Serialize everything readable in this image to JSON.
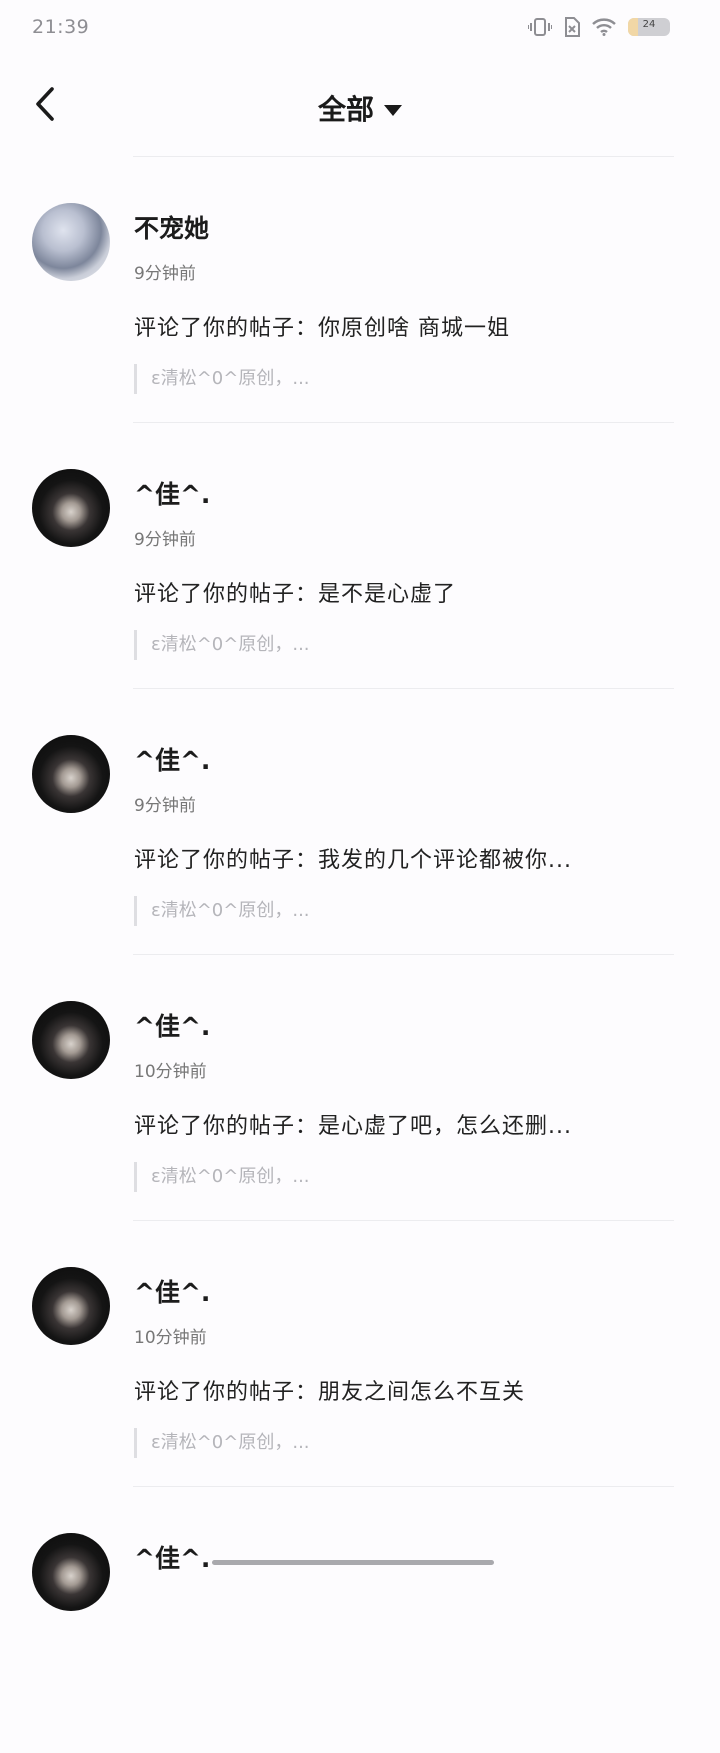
{
  "status_bar": {
    "time": "21:39",
    "battery": "24"
  },
  "nav": {
    "title": "全部"
  },
  "notifications": [
    {
      "user": "不宠她",
      "time": "9分钟前",
      "text": "评论了你的帖子：你原创啥 商城一姐",
      "quote": "ε清松^0^原创，..."
    },
    {
      "user": "^佳^.",
      "time": "9分钟前",
      "text": "评论了你的帖子：是不是心虚了",
      "quote": "ε清松^0^原创，..."
    },
    {
      "user": "^佳^.",
      "time": "9分钟前",
      "text": "评论了你的帖子：我发的几个评论都被你...",
      "quote": "ε清松^0^原创，..."
    },
    {
      "user": "^佳^.",
      "time": "10分钟前",
      "text": "评论了你的帖子：是心虚了吧，怎么还删...",
      "quote": "ε清松^0^原创，..."
    },
    {
      "user": "^佳^.",
      "time": "10分钟前",
      "text": "评论了你的帖子：朋友之间怎么不互关",
      "quote": "ε清松^0^原创，..."
    },
    {
      "user": "^佳^."
    }
  ]
}
